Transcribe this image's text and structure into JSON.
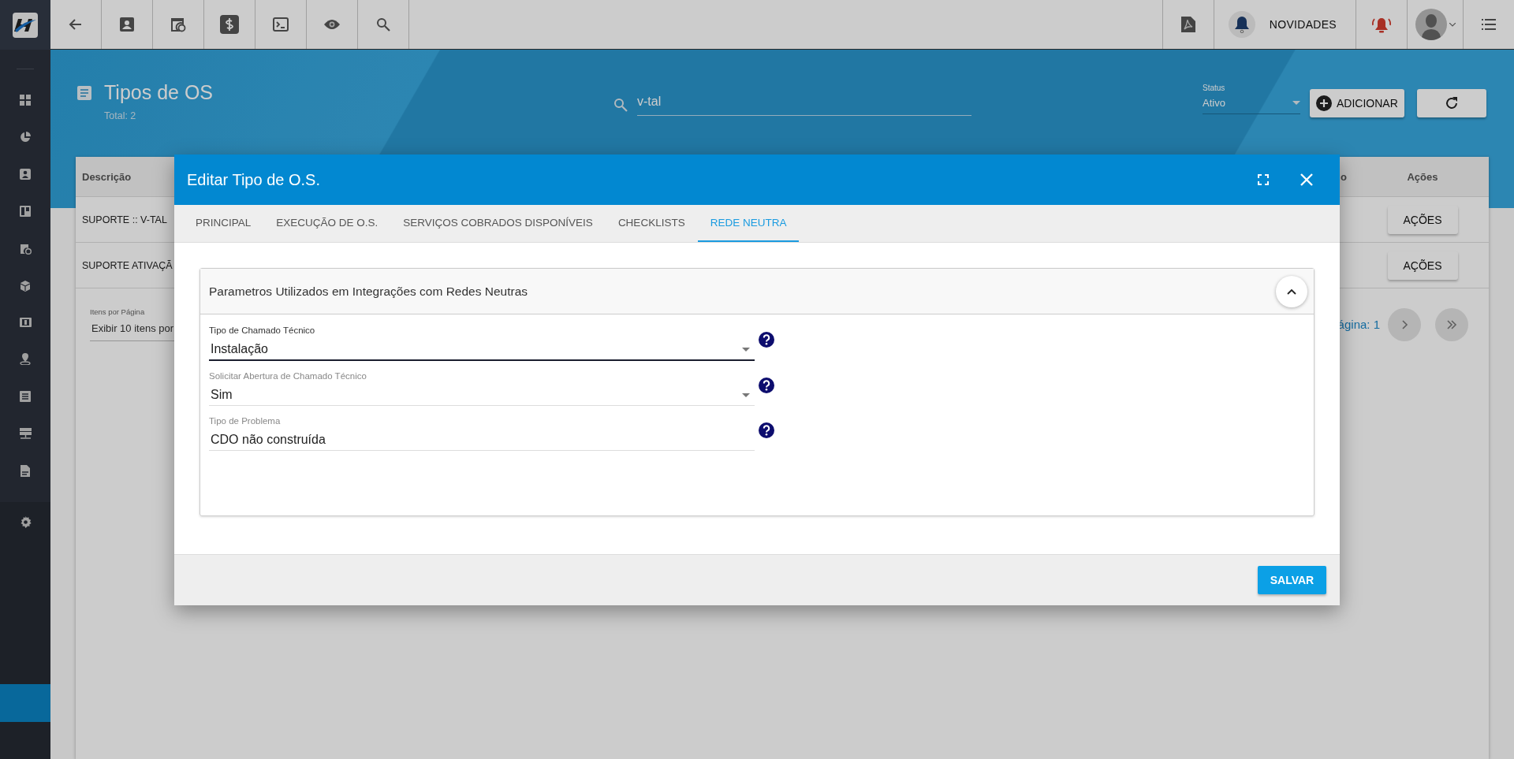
{
  "top_bar": {
    "news_label": "NOVIDADES"
  },
  "page": {
    "title": "Tipos de OS",
    "total": "Total: 2",
    "search": {
      "value": "v-tal"
    },
    "status": {
      "label": "Status",
      "value": "Ativo"
    },
    "add_button": "ADICIONAR"
  },
  "table": {
    "columns": [
      "Descrição",
      "o",
      "Ações"
    ],
    "rows": [
      {
        "description": "SUPORTE :: V-TAL",
        "action": "AÇÕES"
      },
      {
        "description": "SUPORTE ATIVAÇÃ",
        "action": "AÇÕES"
      }
    ],
    "items_per_page": {
      "label": "Itens por Página",
      "value": "Exibir 10 itens por"
    },
    "page_info": "ágina: 1"
  },
  "modal": {
    "title": "Editar Tipo de O.S.",
    "tabs": [
      {
        "label": "PRINCIPAL",
        "selected": false
      },
      {
        "label": "EXECUÇÃO DE O.S.",
        "selected": false
      },
      {
        "label": "SERVIÇOS COBRADOS DISPONÍVEIS",
        "selected": false
      },
      {
        "label": "CHECKLISTS",
        "selected": false
      },
      {
        "label": "REDE NEUTRA",
        "selected": true
      }
    ],
    "section": {
      "title": "Parametros Utilizados em Integrações com Redes Neutras",
      "expanded": true
    },
    "fields": [
      {
        "label": "Tipo de Chamado Técnico",
        "value": "Instalação",
        "kind": "select",
        "focused": true
      },
      {
        "label": "Solicitar Abertura de Chamado Técnico",
        "value": "Sim",
        "kind": "select",
        "focused": false
      },
      {
        "label": "Tipo de Problema",
        "value": "CDO não construída",
        "kind": "text",
        "focused": false
      }
    ],
    "save_button": "SALVAR"
  }
}
